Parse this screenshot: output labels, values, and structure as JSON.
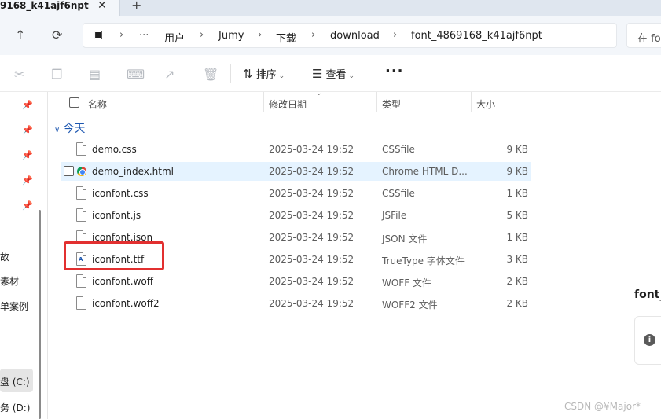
{
  "tab": {
    "title": "9168_k41ajf6npt",
    "close": "✕",
    "new": "+"
  },
  "address": {
    "crumbs": [
      "用户",
      "Jumy",
      "下载",
      "download",
      "font_4869168_k41ajf6npt"
    ],
    "more": "···",
    "search_placeholder": "在 fo"
  },
  "toolbar": {
    "sort_label": "排序",
    "view_label": "查看",
    "more": "···"
  },
  "nav": {
    "items": [
      "故",
      "素材",
      "单案例",
      "盘 (C:)",
      "务 (D:)"
    ]
  },
  "columns": {
    "name": "名称",
    "modified": "修改日期",
    "type": "类型",
    "size": "大小"
  },
  "group": "今天",
  "files": [
    {
      "name": "demo.css",
      "modified": "2025-03-24 19:52",
      "type": "CSSfile",
      "size": "9 KB",
      "icon": "file-icon"
    },
    {
      "name": "demo_index.html",
      "modified": "2025-03-24 19:52",
      "type": "Chrome HTML D...",
      "size": "9 KB",
      "icon": "chrome-icon"
    },
    {
      "name": "iconfont.css",
      "modified": "2025-03-24 19:52",
      "type": "CSSfile",
      "size": "1 KB",
      "icon": "file-icon"
    },
    {
      "name": "iconfont.js",
      "modified": "2025-03-24 19:52",
      "type": "JSFile",
      "size": "5 KB",
      "icon": "file-icon"
    },
    {
      "name": "iconfont.json",
      "modified": "2025-03-24 19:52",
      "type": "JSON 文件",
      "size": "1 KB",
      "icon": "file-icon"
    },
    {
      "name": "iconfont.ttf",
      "modified": "2025-03-24 19:52",
      "type": "TrueType 字体文件",
      "size": "3 KB",
      "icon": "font-file-icon"
    },
    {
      "name": "iconfont.woff",
      "modified": "2025-03-24 19:52",
      "type": "WOFF 文件",
      "size": "2 KB",
      "icon": "file-icon"
    },
    {
      "name": "iconfont.woff2",
      "modified": "2025-03-24 19:52",
      "type": "WOFF2 文件",
      "size": "2 KB",
      "icon": "file-icon"
    }
  ],
  "details": {
    "name": "font_"
  },
  "watermark": "CSDN @¥Major*",
  "colors": {
    "accent": "#1d57b0",
    "highlight": "#e23030",
    "hover": "#e5f3ff"
  }
}
